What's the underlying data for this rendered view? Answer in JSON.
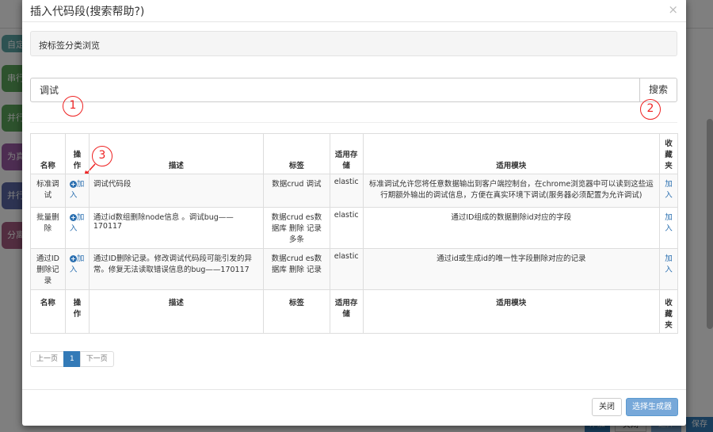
{
  "background": {
    "blocks": [
      {
        "label": "自定",
        "color": "#5ba5a5"
      },
      {
        "label": "串行",
        "color": "#5ba55b"
      },
      {
        "label": "并行",
        "color": "#5ba55b"
      },
      {
        "label": "为真",
        "color": "#9a5ba5"
      },
      {
        "label": "并行",
        "color": "#5b67a5"
      },
      {
        "label": "分离",
        "color": "#a55b80"
      }
    ],
    "footer_buttons": [
      "添加",
      "关闭",
      "选择",
      "保存"
    ]
  },
  "modal": {
    "title": "插入代码段(搜索帮助?)",
    "close_symbol": "×",
    "tag_browse_label": "按标签分类浏览",
    "search": {
      "value": "调试",
      "button_label": "搜索"
    },
    "annotations": [
      "1",
      "2",
      "3"
    ],
    "table": {
      "headers": [
        "名称",
        "操作",
        "描述",
        "标签",
        "适用存储",
        "适用模块",
        "收藏夹"
      ],
      "rows": [
        {
          "name": "标准调试",
          "action": "加入",
          "description": "调试代码段",
          "tags": "数据crud 调试",
          "storage": "elastic",
          "module": "标准调试允许您将任意数据输出到客户端控制台，在chrome浏览器中可以读到这些运行期额外输出的调试信息，方便在真实环境下调试(服务器必须配置为允许调试)",
          "favorite": "加入"
        },
        {
          "name": "批量删除",
          "action": "加入",
          "description": "通过id数组删除node信息 。调试bug——170117",
          "tags": "数据crud es数据库 删除 记录 多条",
          "storage": "elastic",
          "module": "通过ID组成的数据删除id对应的字段",
          "favorite": "加入"
        },
        {
          "name": "通过ID删除记录",
          "action": "加入",
          "description": "通过ID删除记录。修改调试代码段可能引发的异常。修复无法读取错误信息的bug——170117",
          "tags": "数据crud es数据库 删除 记录",
          "storage": "elastic",
          "module": "通过id或生成id的唯一性字段删除对应的记录",
          "favorite": "加入"
        }
      ],
      "footer_headers": [
        "名称",
        "操作",
        "描述",
        "标签",
        "适用存储",
        "适用模块",
        "收藏夹"
      ]
    },
    "pagination": {
      "prev": "上一页",
      "current": "1",
      "next": "下一页"
    },
    "footer": {
      "close_label": "关闭",
      "generate_label": "选择生成器"
    }
  }
}
